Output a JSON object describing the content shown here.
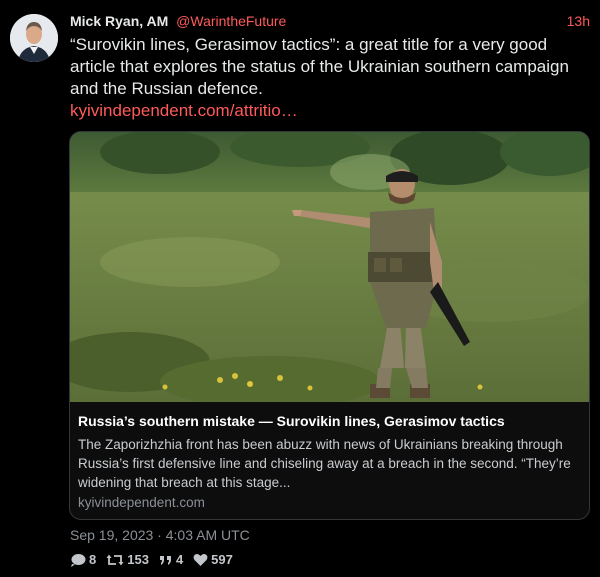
{
  "tweet": {
    "author_name": "Mick Ryan, AM",
    "handle": "@WarintheFuture",
    "time_ago": "13h",
    "text": "“Surovikin lines, Gerasimov tactics”: a great title for a very good article that explores the status of the Ukrainian southern campaign and the Russian defence.",
    "link_text": "kyivindependent.com/attritio…",
    "date_line": "Sep 19, 2023 · 4:03 AM UTC"
  },
  "card": {
    "title": "Russia’s southern mistake — Surovikin lines, Gerasimov tactics",
    "description": "The Zaporizhzhia front has been abuzz with news of Ukrainians breaking through Russia’s first defensive line and chiseling away at a breach in the second. “They’re widening that breach at this stage...",
    "domain": "kyivindependent.com"
  },
  "stats": {
    "replies": "8",
    "retweets": "153",
    "quotes": "4",
    "likes": "597"
  },
  "icons": {
    "reply": "reply-icon",
    "retweet": "retweet-icon",
    "quote": "quote-icon",
    "like": "heart-icon"
  },
  "colors": {
    "background": "#000000",
    "accent": "#ff5a5a",
    "text": "#e7e9ea",
    "muted": "#8b9096"
  }
}
